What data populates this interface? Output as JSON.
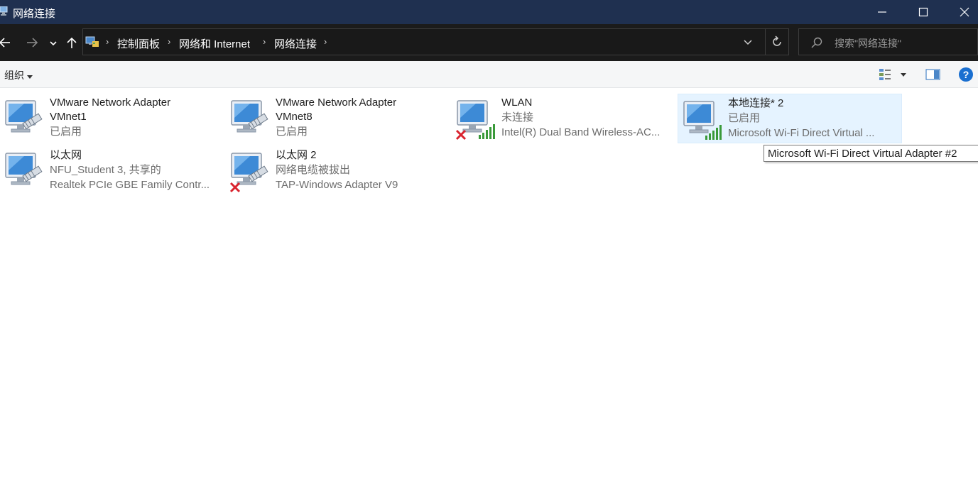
{
  "window": {
    "title": "网络连接"
  },
  "address": {
    "crumbs": [
      "控制面板",
      "网络和 Internet",
      "网络连接"
    ]
  },
  "search": {
    "placeholder": "搜索\"网络连接\""
  },
  "toolbar": {
    "organize_label": "组织"
  },
  "items": [
    {
      "name1": "VMware Network Adapter",
      "name2": "VMnet1",
      "status": "已启用",
      "device": "",
      "type": "wired",
      "disabled": false,
      "selected": false
    },
    {
      "name1": "VMware Network Adapter",
      "name2": "VMnet8",
      "status": "已启用",
      "device": "",
      "type": "wired",
      "disabled": false,
      "selected": false
    },
    {
      "name1": "WLAN",
      "name2": "",
      "status": "未连接",
      "device": "Intel(R) Dual Band Wireless-AC...",
      "type": "wifi",
      "disabled": true,
      "selected": false
    },
    {
      "name1": "本地连接* 2",
      "name2": "",
      "status": "已启用",
      "device": "Microsoft Wi-Fi Direct Virtual ...",
      "type": "wifi",
      "disabled": false,
      "selected": true
    },
    {
      "name1": "以太网",
      "name2": "",
      "status": "NFU_Student 3, 共享的",
      "device": "Realtek PCIe GBE Family Contr...",
      "type": "wired",
      "disabled": false,
      "selected": false
    },
    {
      "name1": "以太网 2",
      "name2": "",
      "status": "网络电缆被拔出",
      "device": "TAP-Windows Adapter V9",
      "type": "wired",
      "disabled": true,
      "selected": false
    }
  ],
  "tooltip": {
    "text": "Microsoft Wi-Fi Direct Virtual Adapter #2"
  },
  "colors": {
    "titlebar": "#1f3050",
    "addressbar": "#1b1b1b",
    "selection": "#e5f3ff",
    "disconnect_x": "#d9232e",
    "signal": "#3a9a3a"
  }
}
